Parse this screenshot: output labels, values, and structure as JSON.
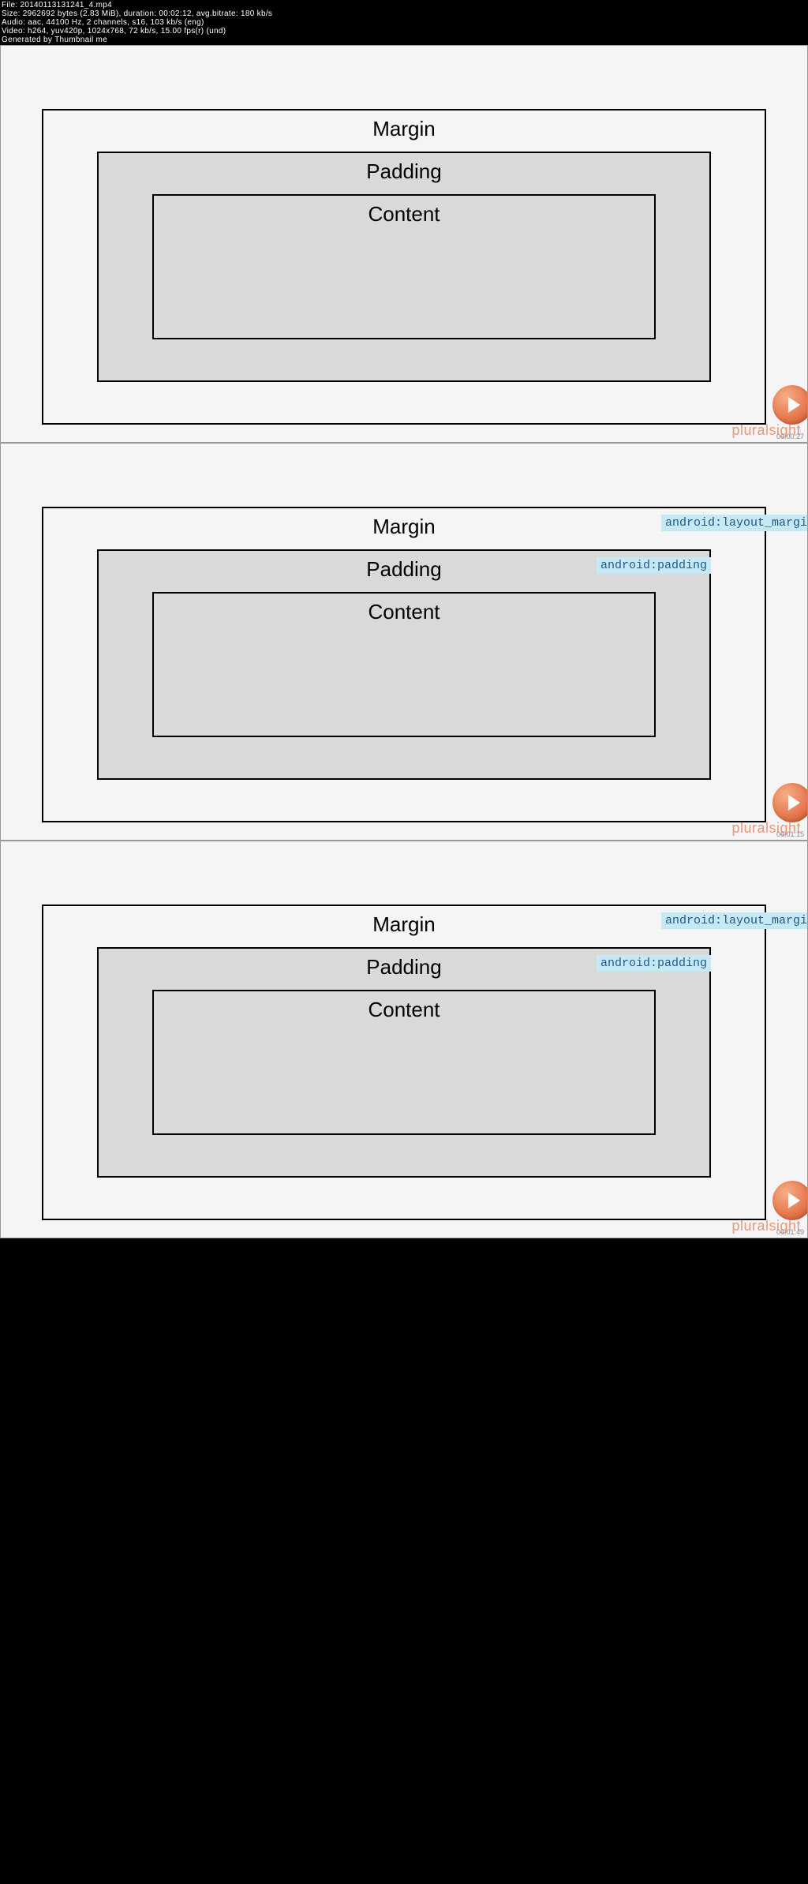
{
  "header": {
    "file": "File: 20140113131241_4.mp4",
    "size": "Size: 2962692 bytes (2.83 MiB), duration: 00:02:12, avg.bitrate: 180 kb/s",
    "audio": "Audio: aac, 44100 Hz, 2 channels, s16, 103 kb/s (eng)",
    "video": "Video: h264, yuv420p, 1024x768, 72 kb/s, 15.00 fps(r) (und)",
    "generated": "Generated by Thumbnail me"
  },
  "labels": {
    "margin": "Margin",
    "padding": "Padding",
    "content": "Content"
  },
  "codes": {
    "margin": "android:layout_margin",
    "padding": "android:padding"
  },
  "frames": [
    {
      "show_codes": false,
      "timestamp": "00:00:27"
    },
    {
      "show_codes": true,
      "timestamp": "00:01:15"
    },
    {
      "show_codes": true,
      "timestamp": "00:01:49"
    }
  ],
  "brand": "pluralsight"
}
